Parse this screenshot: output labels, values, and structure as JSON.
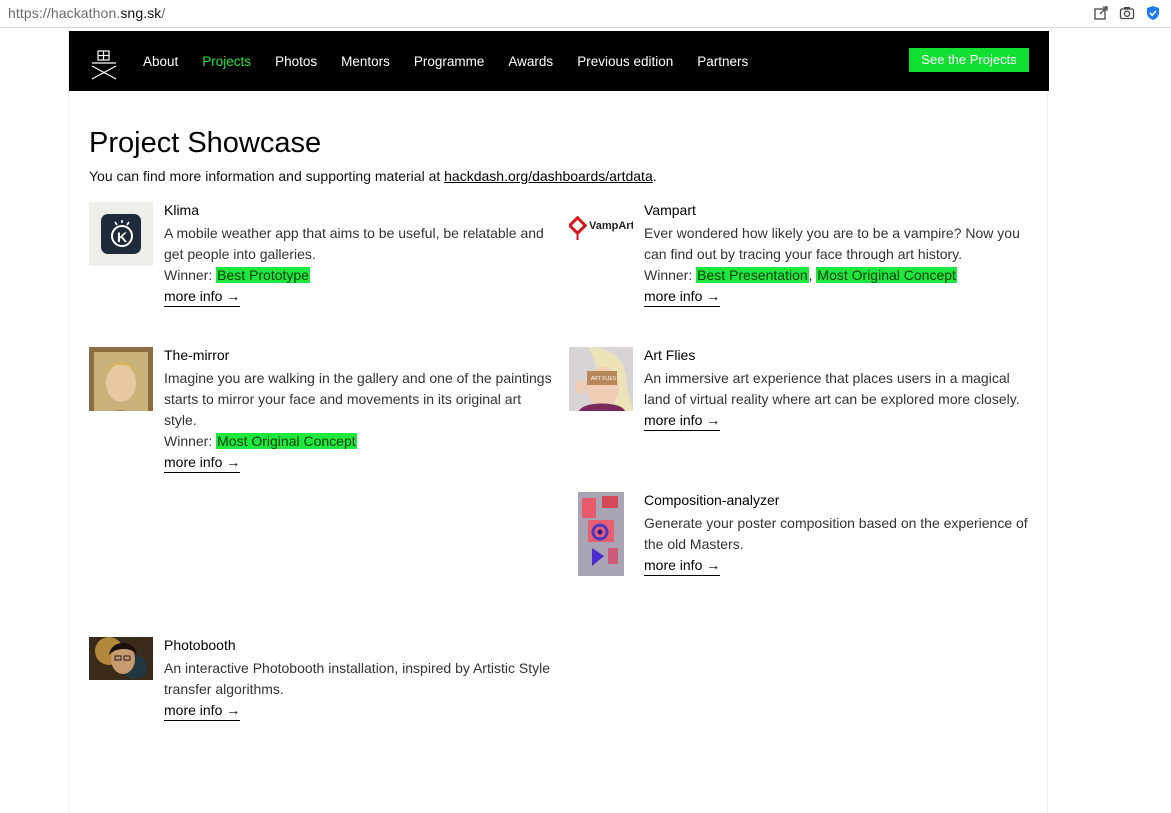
{
  "browser": {
    "url_prefix": "https://hackathon.",
    "url_host": "sng.sk",
    "url_suffix": "/"
  },
  "nav": {
    "items": [
      {
        "label": "About",
        "active": false
      },
      {
        "label": "Projects",
        "active": true
      },
      {
        "label": "Photos",
        "active": false
      },
      {
        "label": "Mentors",
        "active": false
      },
      {
        "label": "Programme",
        "active": false
      },
      {
        "label": "Awards",
        "active": false
      },
      {
        "label": "Previous edition",
        "active": false
      },
      {
        "label": "Partners",
        "active": false
      }
    ],
    "cta_label": "See the Projects"
  },
  "main": {
    "title": "Project Showcase",
    "intro_text": "You can find more information and supporting material at ",
    "intro_link": "hackdash.org/dashboards/artdata",
    "intro_end": "."
  },
  "winner_label": "Winner: ",
  "more_info_label": "more info →",
  "projects": [
    {
      "title": "Klima",
      "description": "A mobile weather app that aims to be useful, be relatable and get people into galleries.",
      "awards": [
        "Best Prototype"
      ]
    },
    {
      "title": "Vampart",
      "thumb_text": "VampArt",
      "description": "Ever wondered how likely you are to be a vampire? Now you can find out by tracing your face through art history.",
      "awards": [
        "Best Presentation",
        "Most Original Concept"
      ]
    },
    {
      "title": "The-mirror",
      "description": "Imagine you are walking in the gallery and one of the paintings starts to mirror your face and movements in its original art style.",
      "awards": [
        "Most Original Concept"
      ]
    },
    {
      "title": "Art Flies",
      "thumb_text": "ART FLIES",
      "description": "An immersive art experience that places users in a magical land of virtual reality where art can be explored more closely.",
      "awards": []
    },
    {
      "title": "Composition-analyzer",
      "description": "Generate your poster composition based on the experience of the old Masters.",
      "awards": []
    },
    {
      "title": "Photobooth",
      "description": "An interactive Photobooth installation, inspired by Artistic Style transfer algorithms.",
      "awards": []
    }
  ],
  "colors": {
    "navbar_bg": "#000000",
    "accent_green": "#10e032",
    "badge_green": "#1ee83d"
  }
}
